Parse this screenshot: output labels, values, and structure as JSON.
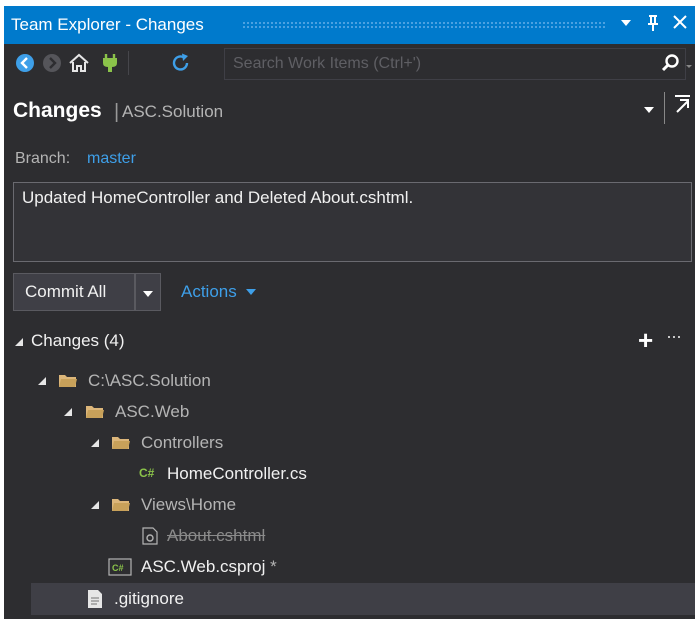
{
  "window": {
    "title": "Team Explorer - Changes"
  },
  "toolbar": {
    "search_placeholder": "Search Work Items (Ctrl+')"
  },
  "header": {
    "title": "Changes",
    "separator": "|",
    "solution": "ASC.Solution"
  },
  "branch": {
    "label": "Branch:",
    "value": "master"
  },
  "commit": {
    "message": "Updated HomeController and Deleted About.cshtml.",
    "button_label": "Commit All",
    "actions_label": "Actions"
  },
  "changes": {
    "header": "Changes (4)",
    "tree": [
      {
        "label": "C:\\ASC.Solution",
        "icon": "folder-icon",
        "expanded": true
      },
      {
        "label": "ASC.Web",
        "icon": "folder-icon",
        "expanded": true
      },
      {
        "label": "Controllers",
        "icon": "folder-icon",
        "expanded": true
      },
      {
        "label": "HomeController.cs",
        "icon": "csharp-file-icon"
      },
      {
        "label": "Views\\Home",
        "icon": "folder-icon",
        "expanded": true
      },
      {
        "label": "About.cshtml",
        "icon": "razor-file-icon",
        "status": "deleted"
      },
      {
        "label": "ASC.Web.csproj",
        "suffix": " *",
        "icon": "csproj-file-icon"
      },
      {
        "label": ".gitignore",
        "icon": "text-file-icon",
        "selected": true
      }
    ]
  },
  "colors": {
    "titlebar": "#007acc",
    "background": "#2d2d30",
    "link": "#3e9fe8",
    "selection": "#3f3f46"
  }
}
